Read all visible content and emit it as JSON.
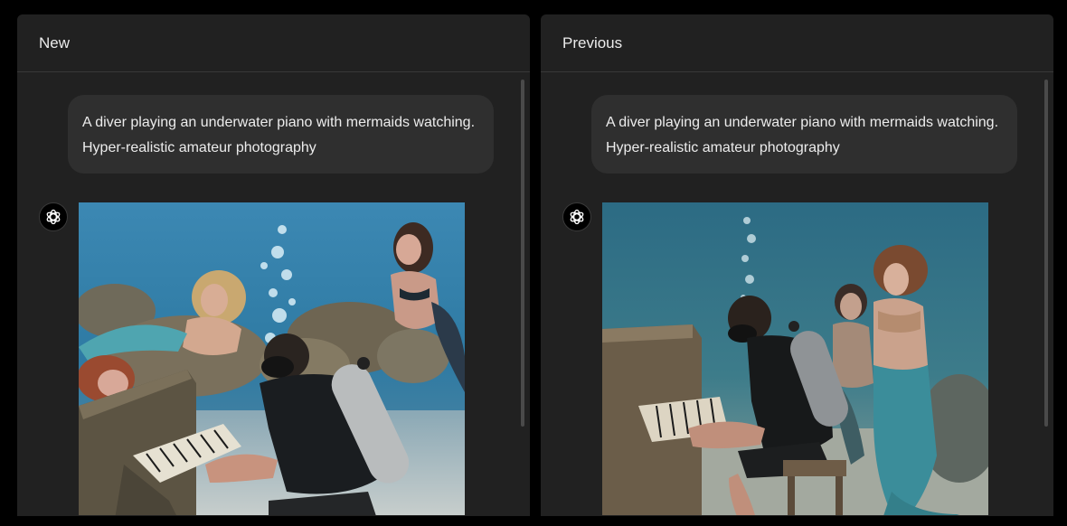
{
  "panels": {
    "left": {
      "title": "New",
      "prompt": "A diver playing an underwater piano with mermaids watching. Hyper-realistic amateur photography",
      "image_alt": "Diver in scuba gear playing a coral-covered piano underwater while three mermaids watch"
    },
    "right": {
      "title": "Previous",
      "prompt": "A diver playing an underwater piano with mermaids watching. Hyper-realistic amateur photography",
      "image_alt": "Diver in black wetsuit playing an old upright piano on the sea floor with two mermaids standing beside"
    }
  },
  "icons": {
    "assistant_avatar": "openai-logo-icon"
  },
  "colors": {
    "background": "#000000",
    "panel": "#212121",
    "bubble": "#2f2f2f",
    "text": "#ececec"
  }
}
